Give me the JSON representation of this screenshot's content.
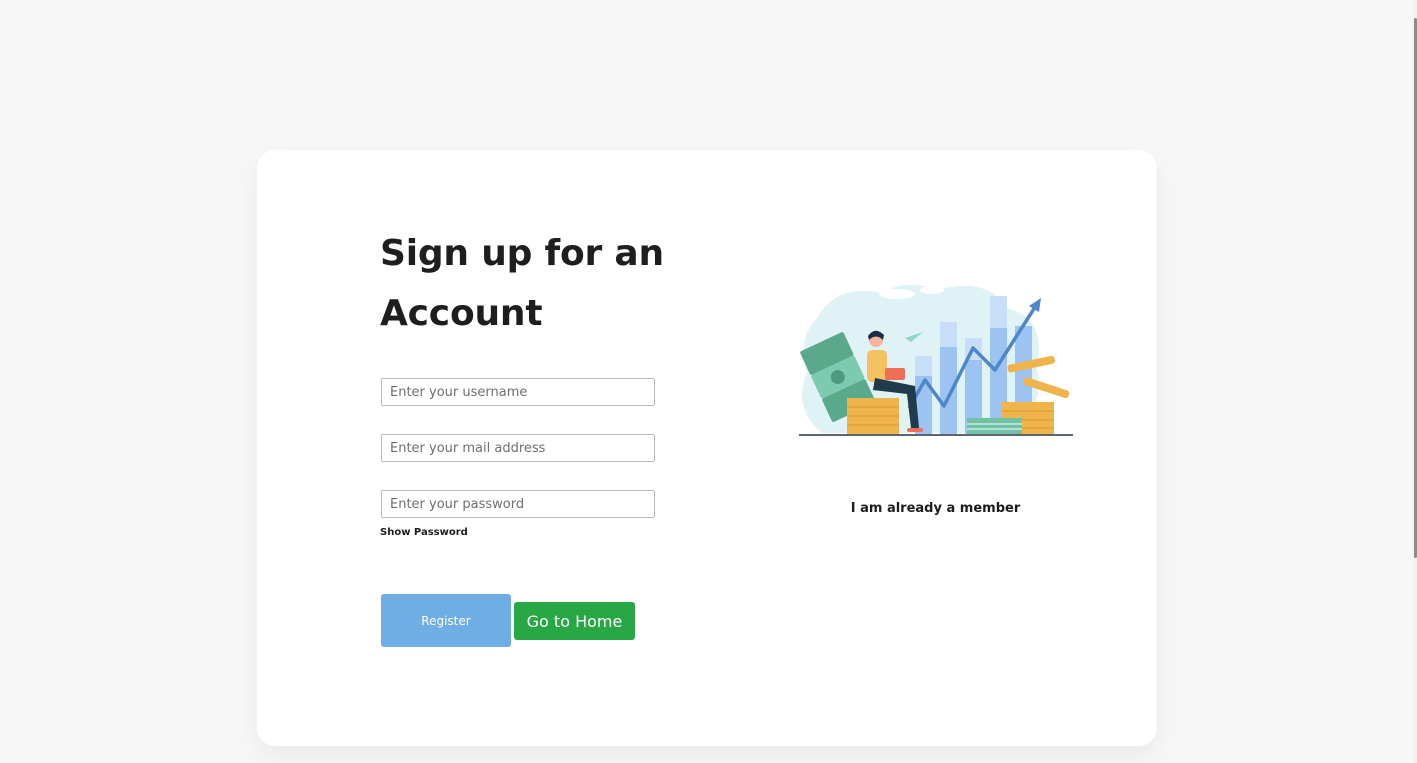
{
  "form": {
    "title": "Sign up for an Account",
    "username_placeholder": "Enter your username",
    "email_placeholder": "Enter your mail address",
    "password_placeholder": "Enter your password",
    "show_password_label": "Show Password",
    "register_label": "Register",
    "home_label": "Go to Home"
  },
  "side": {
    "member_link_label": "I am already a member"
  },
  "colors": {
    "register_button": "#6faee4",
    "home_button": "#28a745",
    "chart_bar": "#9dc3f2",
    "trend_line": "#4f86c6",
    "coin": "#f0b44d",
    "money": "#6fc2a4"
  },
  "illustration": {
    "name": "finance-growth-illustration"
  }
}
